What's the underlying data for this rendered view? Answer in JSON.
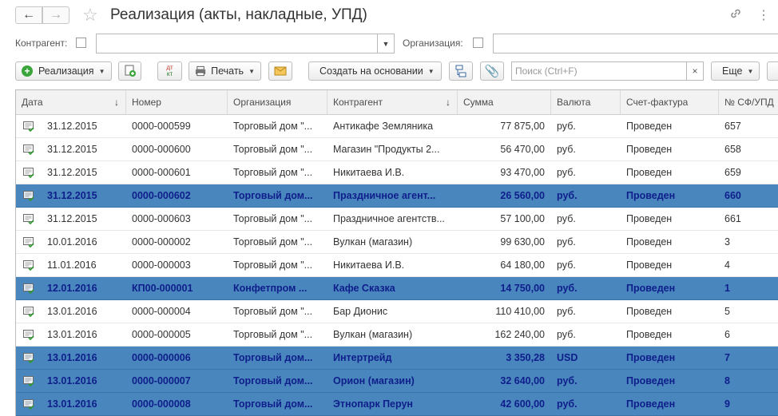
{
  "window": {
    "title": "Реализация (акты, накладные, УПД)",
    "icons": [
      "back-arrow-icon",
      "forward-arrow-icon",
      "star-icon",
      "link-icon",
      "more-icon"
    ]
  },
  "filters": {
    "contractor_label": "Контрагент:",
    "organization_label": "Организация:",
    "contractor_value": "",
    "organization_value": ""
  },
  "toolbar": {
    "create_label": "Реализация",
    "print_label": "Печать",
    "base_label": "Создать на основании",
    "search_placeholder": "Поиск (Ctrl+F)",
    "search_clear": "×",
    "more_label": "Еще",
    "dt_kt_top": "дт",
    "dt_kt_bottom": "кт"
  },
  "table": {
    "columns": [
      "Дата",
      "Номер",
      "Организация",
      "Контрагент",
      "Сумма",
      "Валюта",
      "Счет-фактура",
      "№ СФ/УПД"
    ],
    "sort_marks": [
      "↓",
      "↓"
    ],
    "rows": [
      {
        "date": "31.12.2015",
        "number": "0000-000599",
        "org": "Торговый дом \"...",
        "contractor": "Антикафе Земляника",
        "sum": "77 875,00",
        "currency": "руб.",
        "invoice": "Проведен",
        "sf": "657",
        "selected": false
      },
      {
        "date": "31.12.2015",
        "number": "0000-000600",
        "org": "Торговый дом \"...",
        "contractor": "Магазин \"Продукты 2...",
        "sum": "56 470,00",
        "currency": "руб.",
        "invoice": "Проведен",
        "sf": "658",
        "selected": false
      },
      {
        "date": "31.12.2015",
        "number": "0000-000601",
        "org": "Торговый дом \"...",
        "contractor": "Никитаева И.В.",
        "sum": "93 470,00",
        "currency": "руб.",
        "invoice": "Проведен",
        "sf": "659",
        "selected": false
      },
      {
        "date": "31.12.2015",
        "number": "0000-000602",
        "org": "Торговый дом...",
        "contractor": "Праздничное агент...",
        "sum": "26 560,00",
        "currency": "руб.",
        "invoice": "Проведен",
        "sf": "660",
        "selected": true
      },
      {
        "date": "31.12.2015",
        "number": "0000-000603",
        "org": "Торговый дом \"...",
        "contractor": "Праздничное агентств...",
        "sum": "57 100,00",
        "currency": "руб.",
        "invoice": "Проведен",
        "sf": "661",
        "selected": false
      },
      {
        "date": "10.01.2016",
        "number": "0000-000002",
        "org": "Торговый дом \"...",
        "contractor": "Вулкан (магазин)",
        "sum": "99 630,00",
        "currency": "руб.",
        "invoice": "Проведен",
        "sf": "3",
        "selected": false
      },
      {
        "date": "11.01.2016",
        "number": "0000-000003",
        "org": "Торговый дом \"...",
        "contractor": "Никитаева И.В.",
        "sum": "64 180,00",
        "currency": "руб.",
        "invoice": "Проведен",
        "sf": "4",
        "selected": false
      },
      {
        "date": "12.01.2016",
        "number": "КП00-000001",
        "org": "Конфетпром ...",
        "contractor": "Кафе Сказка",
        "sum": "14 750,00",
        "currency": "руб.",
        "invoice": "Проведен",
        "sf": "1",
        "selected": true
      },
      {
        "date": "13.01.2016",
        "number": "0000-000004",
        "org": "Торговый дом \"...",
        "contractor": "Бар Дионис",
        "sum": "110 410,00",
        "currency": "руб.",
        "invoice": "Проведен",
        "sf": "5",
        "selected": false
      },
      {
        "date": "13.01.2016",
        "number": "0000-000005",
        "org": "Торговый дом \"...",
        "contractor": "Вулкан (магазин)",
        "sum": "162 240,00",
        "currency": "руб.",
        "invoice": "Проведен",
        "sf": "6",
        "selected": false
      },
      {
        "date": "13.01.2016",
        "number": "0000-000006",
        "org": "Торговый дом...",
        "contractor": "Интертрейд",
        "sum": "3 350,28",
        "currency": "USD",
        "invoice": "Проведен",
        "sf": "7",
        "selected": true
      },
      {
        "date": "13.01.2016",
        "number": "0000-000007",
        "org": "Торговый дом...",
        "contractor": "Орион (магазин)",
        "sum": "32 640,00",
        "currency": "руб.",
        "invoice": "Проведен",
        "sf": "8",
        "selected": true
      },
      {
        "date": "13.01.2016",
        "number": "0000-000008",
        "org": "Торговый дом...",
        "contractor": "Этнопарк Перун",
        "sum": "42 600,00",
        "currency": "руб.",
        "invoice": "Проведен",
        "sf": "9",
        "selected": true
      }
    ]
  },
  "colors": {
    "selection": "#4a86be",
    "selected_text": "#0e1e8a",
    "accent_green": "#3aa53a"
  }
}
